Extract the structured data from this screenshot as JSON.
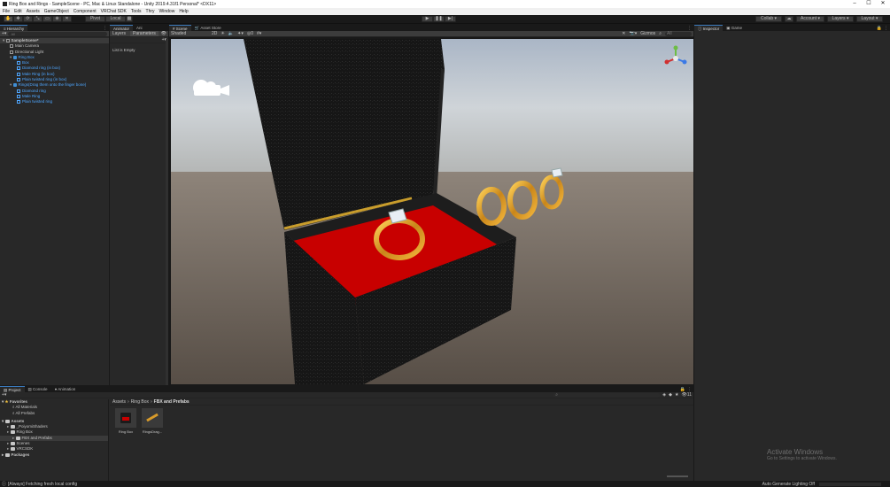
{
  "window": {
    "title": "Ring Box and Rings - SampleScene - PC, Mac & Linux Standalone - Unity 2019.4.31f1 Personal* <DX11>",
    "controls": [
      "–",
      "☐",
      "✕"
    ]
  },
  "menu": [
    "File",
    "Edit",
    "Assets",
    "GameObject",
    "Component",
    "VRChat SDK",
    "Tools",
    "Thry",
    "Window",
    "Help"
  ],
  "toolbar": {
    "pivot": "Pivot",
    "local": "Local",
    "collab": "Collab ▾",
    "account": "Account ▾",
    "layers": "Layers ▾",
    "layout": "Layout ▾"
  },
  "hierarchy": {
    "tab": "Hierarchy",
    "search_placeholder": "All",
    "items": [
      {
        "label": "SampleScene*",
        "indent": 0,
        "kind": "scene"
      },
      {
        "label": "Main Camera",
        "indent": 1,
        "kind": "obj"
      },
      {
        "label": "Directional Light",
        "indent": 1,
        "kind": "obj"
      },
      {
        "label": "Ring Box",
        "indent": 1,
        "kind": "prefab"
      },
      {
        "label": "Box",
        "indent": 2,
        "kind": "prefab-child"
      },
      {
        "label": "Diamond ring (in box)",
        "indent": 2,
        "kind": "prefab-child"
      },
      {
        "label": "Male Ring (in box)",
        "indent": 2,
        "kind": "prefab-child"
      },
      {
        "label": "Plain twisted ring (in box)",
        "indent": 2,
        "kind": "prefab-child"
      },
      {
        "label": "Rings(Drag them onto the finger bone)",
        "indent": 1,
        "kind": "prefab"
      },
      {
        "label": "Diamond ring",
        "indent": 2,
        "kind": "prefab-child"
      },
      {
        "label": "Male Ring",
        "indent": 2,
        "kind": "prefab-child"
      },
      {
        "label": "Plain twisted ring",
        "indent": 2,
        "kind": "prefab-child"
      }
    ]
  },
  "animator": {
    "tabs": [
      "Animator",
      "Ani"
    ],
    "subtabs": [
      "Layers",
      "Parameters"
    ],
    "list_empty": "List is Empty"
  },
  "scene": {
    "tabs": [
      "Scene",
      "Asset Store"
    ],
    "shading": "Shaded",
    "mode": "2D",
    "gizmos": "Gizmos",
    "search_placeholder": "All"
  },
  "inspector": {
    "tabs": [
      "Inspector",
      "Game"
    ]
  },
  "project": {
    "tabs": [
      "Project",
      "Console",
      "Animation"
    ],
    "favorites_label": "Favorites",
    "favorites": [
      "All Materials",
      "All Prefabs"
    ],
    "assets_label": "Assets",
    "asset_tree": [
      {
        "label": "_PoiyomiShaders",
        "indent": 1
      },
      {
        "label": "Ring Box",
        "indent": 1
      },
      {
        "label": "FBX and Prefabs",
        "indent": 2,
        "selected": true
      },
      {
        "label": "Scenes",
        "indent": 1
      },
      {
        "label": "VRCSDK",
        "indent": 1
      }
    ],
    "packages_label": "Packages",
    "breadcrumb": [
      "Assets",
      "Ring Box",
      "FBX and Prefabs"
    ],
    "files": [
      {
        "label": "Ring Box"
      },
      {
        "label": "RingsDrag..."
      }
    ],
    "hidden_count": "11"
  },
  "status": {
    "message": "[Always] Fetching fresh local config",
    "lighting": "Auto Generate Lighting Off"
  },
  "watermark": {
    "title": "Activate Windows",
    "subtitle": "Go to Settings to activate Windows."
  },
  "colors": {
    "accent": "#3a79bb",
    "prefab": "#4ea6ff",
    "box_velvet": "#c80000"
  }
}
